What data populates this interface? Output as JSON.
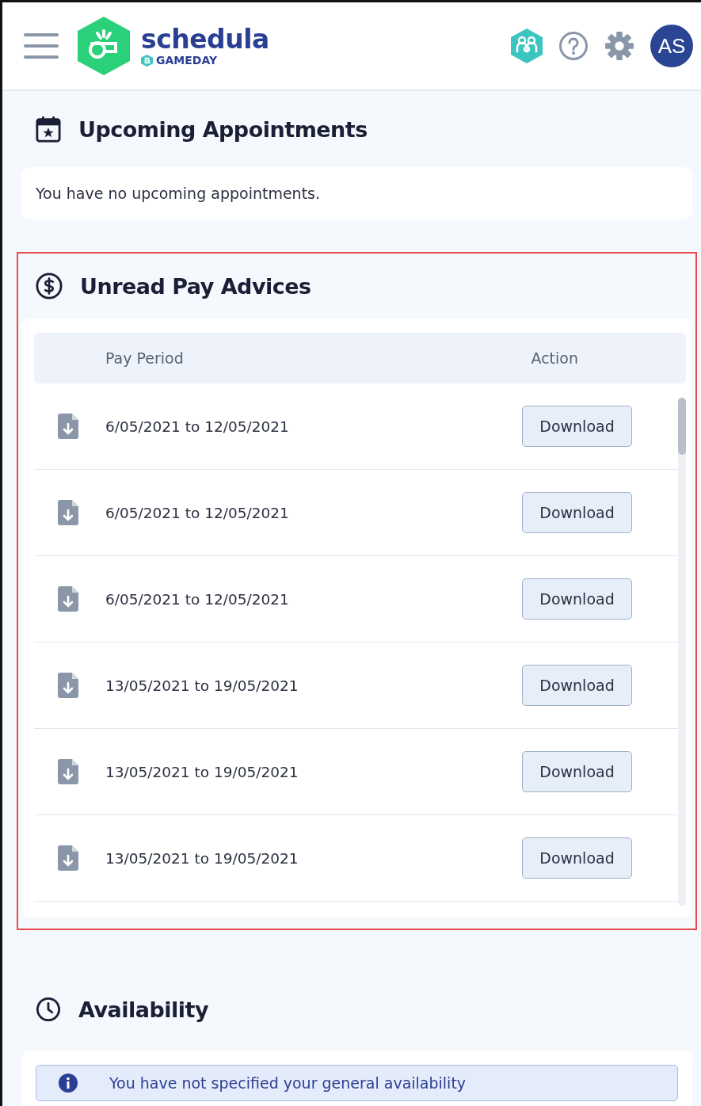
{
  "header": {
    "brand": "schedula",
    "sub_brand": "GAMEDAY",
    "avatar": "AS"
  },
  "appointments": {
    "title": "Upcoming Appointments",
    "message": "You have no upcoming appointments."
  },
  "pay_advices": {
    "title": "Unread Pay Advices",
    "highlighted": true,
    "columns": [
      "Pay Period",
      "Action"
    ],
    "rows": [
      {
        "period": "6/05/2021 to 12/05/2021",
        "action": "Download"
      },
      {
        "period": "6/05/2021 to 12/05/2021",
        "action": "Download"
      },
      {
        "period": "6/05/2021 to 12/05/2021",
        "action": "Download"
      },
      {
        "period": "13/05/2021 to 19/05/2021",
        "action": "Download"
      },
      {
        "period": "13/05/2021 to 19/05/2021",
        "action": "Download"
      },
      {
        "period": "13/05/2021 to 19/05/2021",
        "action": "Download"
      }
    ]
  },
  "availability": {
    "title": "Availability",
    "message": "You have not specified your general availability"
  }
}
